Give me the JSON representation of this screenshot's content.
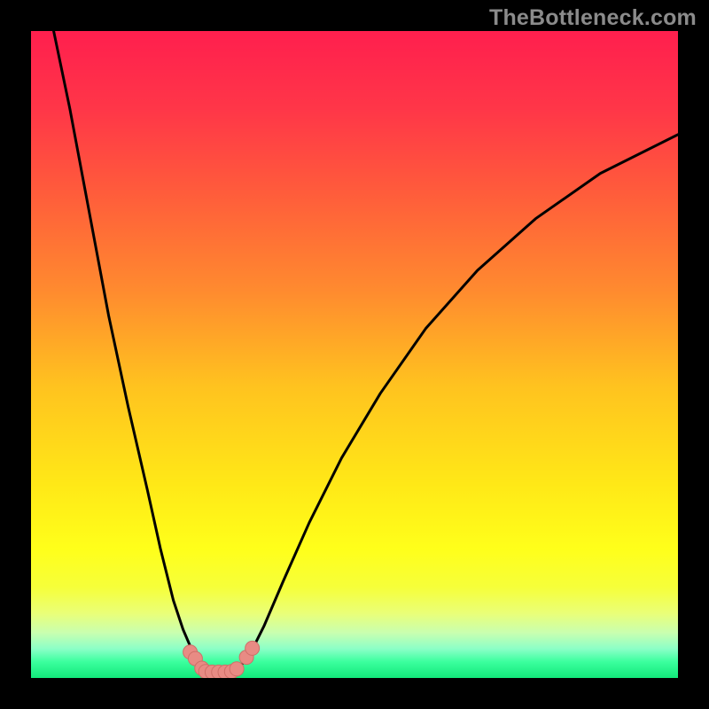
{
  "watermark": "TheBottleneck.com",
  "colors": {
    "background_black": "#000000",
    "line_stroke": "#000000",
    "marker_fill": "#e88b84",
    "marker_stroke": "#cf6f68",
    "gradient_stops": [
      {
        "offset": 0.0,
        "color": "#ff1f4e"
      },
      {
        "offset": 0.12,
        "color": "#ff3648"
      },
      {
        "offset": 0.25,
        "color": "#ff5c3b"
      },
      {
        "offset": 0.4,
        "color": "#ff8a2f"
      },
      {
        "offset": 0.55,
        "color": "#ffc31f"
      },
      {
        "offset": 0.7,
        "color": "#ffe817"
      },
      {
        "offset": 0.8,
        "color": "#ffff1a"
      },
      {
        "offset": 0.86,
        "color": "#f6ff3a"
      },
      {
        "offset": 0.9,
        "color": "#eaff78"
      },
      {
        "offset": 0.93,
        "color": "#c9ffb0"
      },
      {
        "offset": 0.955,
        "color": "#8bffc7"
      },
      {
        "offset": 0.975,
        "color": "#3bff9e"
      },
      {
        "offset": 1.0,
        "color": "#12e87a"
      }
    ]
  },
  "chart_data": {
    "type": "line",
    "title": "",
    "xlabel": "",
    "ylabel": "",
    "xlim": [
      0,
      100
    ],
    "ylim": [
      0,
      100
    ],
    "series": [
      {
        "name": "curve-left",
        "x": [
          3.5,
          6,
          9,
          12,
          15,
          18,
          20,
          22,
          23.5,
          25,
          26,
          27,
          27.8
        ],
        "y": [
          100,
          88,
          72,
          56,
          42,
          29,
          20,
          12,
          7.5,
          4,
          2.3,
          1.3,
          1
        ]
      },
      {
        "name": "curve-right",
        "x": [
          31,
          32.5,
          34,
          36,
          39,
          43,
          48,
          54,
          61,
          69,
          78,
          88,
          100
        ],
        "y": [
          1,
          2,
          4,
          8,
          15,
          24,
          34,
          44,
          54,
          63,
          71,
          78,
          84
        ]
      }
    ],
    "markers": [
      {
        "x": 24.6,
        "y": 4.0
      },
      {
        "x": 25.4,
        "y": 3.0
      },
      {
        "x": 26.4,
        "y": 1.5
      },
      {
        "x": 27.0,
        "y": 1.0
      },
      {
        "x": 28.0,
        "y": 0.9
      },
      {
        "x": 29.0,
        "y": 0.9
      },
      {
        "x": 30.0,
        "y": 0.9
      },
      {
        "x": 31.0,
        "y": 1.0
      },
      {
        "x": 31.8,
        "y": 1.4
      },
      {
        "x": 33.3,
        "y": 3.2
      },
      {
        "x": 34.2,
        "y": 4.6
      }
    ]
  }
}
